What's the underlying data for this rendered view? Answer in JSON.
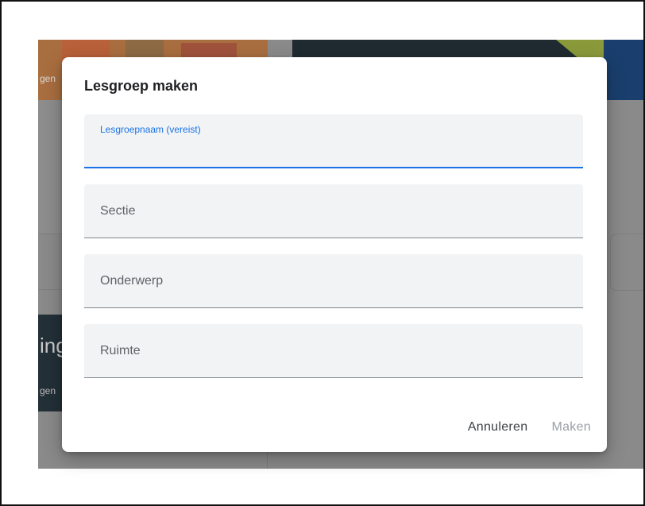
{
  "background": {
    "left_card_fragment_1": "gen",
    "left_card_fragment_2": "ing",
    "left_card_fragment_3": "gen"
  },
  "dialog": {
    "title": "Lesgroep maken",
    "fields": [
      {
        "label": "Lesgroepnaam (vereist)",
        "value": "",
        "state": "focused"
      },
      {
        "label": "Sectie",
        "value": ""
      },
      {
        "label": "Onderwerp",
        "value": ""
      },
      {
        "label": "Ruimte",
        "value": ""
      }
    ],
    "actions": {
      "cancel": "Annuleren",
      "create": "Maken"
    }
  },
  "colors": {
    "accent": "#1a73e8",
    "disabled": "#9aa0a6",
    "field_bg": "#f1f3f4",
    "scrim": "#8a8a8a"
  }
}
